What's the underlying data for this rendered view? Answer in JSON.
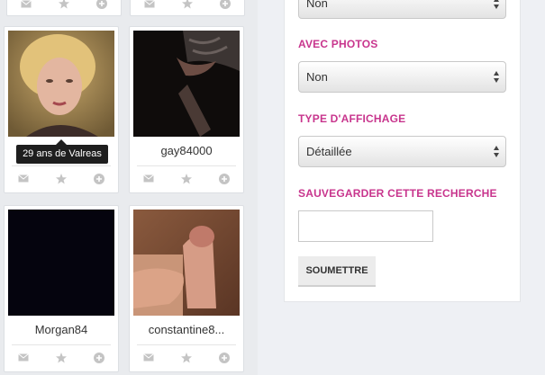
{
  "profiles": [
    {
      "name": "",
      "tooltip": "29 ans de Valreas"
    },
    {
      "name": "gay84000"
    },
    {
      "name": "Morgan84"
    },
    {
      "name": "constantine8..."
    }
  ],
  "card_actions": [
    "mail-icon",
    "star-icon",
    "plus-circle-icon"
  ],
  "search_panel": {
    "top_select_value": "Non",
    "photos_label": "AVEC PHOTOS",
    "photos_value": "Non",
    "display_label": "TYPE D'AFFICHAGE",
    "display_value": "Détaillée",
    "save_label": "SAUVEGARDER CETTE RECHERCHE",
    "save_value": "",
    "submit_label": "SOUMETTRE"
  },
  "colors": {
    "accent": "#c8358d",
    "background": "#eef0f4"
  }
}
